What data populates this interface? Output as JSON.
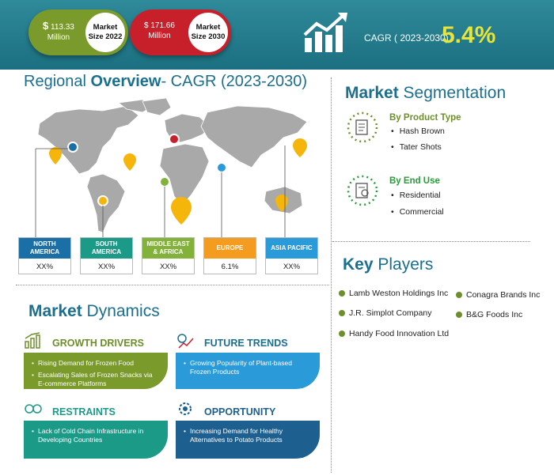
{
  "banner": {
    "pill2022": {
      "currency": "$",
      "amount": "113.33",
      "unit": "Million",
      "label_line1": "Market",
      "label_line2": "Size 2022"
    },
    "pill2030": {
      "currency": "$",
      "amount": "171.66",
      "unit": "Million",
      "label_line1": "Market",
      "label_line2": "Size 2030"
    },
    "cagr_label": "CAGR ( 2023-2030)",
    "cagr_value": "5.4%",
    "colors": {
      "banner": "#1b6f80",
      "pill2022": "#7a9a2b",
      "pill2030": "#c8202b",
      "cagr": "#e8e53a"
    }
  },
  "regional": {
    "title_part1": "Regional ",
    "title_bold": "Overview",
    "title_part2": "- CAGR (2023-2030)",
    "regions": [
      {
        "name_line1": "NORTH",
        "name_line2": "AMERICA",
        "value": "XX%",
        "color": "#1a6fa6"
      },
      {
        "name_line1": "SOUTH",
        "name_line2": "AMERICA",
        "value": "XX%",
        "color": "#1c9a88"
      },
      {
        "name_line1": "MIDDLE EAST",
        "name_line2": "& AFRICA",
        "value": "XX%",
        "color": "#83b23a"
      },
      {
        "name_line1": "EUROPE",
        "name_line2": "",
        "value": "6.1%",
        "color": "#f39c1f"
      },
      {
        "name_line1": "ASIA PACIFIC",
        "name_line2": "",
        "value": "XX%",
        "color": "#2a9ad8"
      }
    ]
  },
  "segmentation": {
    "title_bold": "Market",
    "title_rest": " Segmentation",
    "groups": [
      {
        "heading": "By Product Type",
        "color": "#6d8f2a",
        "items": [
          "Hash Brown",
          "Tater Shots"
        ]
      },
      {
        "heading": "By End Use",
        "color": "#2a9a3a",
        "items": [
          "Residential",
          "Commercial"
        ]
      }
    ]
  },
  "key_players": {
    "title_bold": "Key",
    "title_rest": " Players",
    "players": [
      "Lamb Weston Holdings Inc",
      "Conagra Brands Inc",
      "J.R. Simplot Company",
      "B&G Foods Inc",
      "Handy Food Innovation Ltd"
    ]
  },
  "dynamics": {
    "title_bold": "Market",
    "title_rest": " Dynamics",
    "growth_drivers": {
      "heading": "GROWTH DRIVERS",
      "items": [
        "Rising Demand for Frozen Food",
        "Escalating Sales of Frozen Snacks via E-commerce Platforms"
      ],
      "color": "#7a9a2b"
    },
    "future_trends": {
      "heading": "FUTURE TRENDS",
      "items": [
        "Growing Popularity of Plant-based Frozen Products"
      ],
      "color": "#2a9ad8"
    },
    "restraints": {
      "heading": "RESTRAINTS",
      "items": [
        "Lack of Cold Chain Infrastructure in Developing Countries"
      ],
      "color": "#1c9a88"
    },
    "opportunity": {
      "heading": "OPPORTUNITY",
      "items": [
        "Increasing Demand for Healthy Alternatives to Potato Products"
      ],
      "color": "#1d5f8f"
    }
  }
}
